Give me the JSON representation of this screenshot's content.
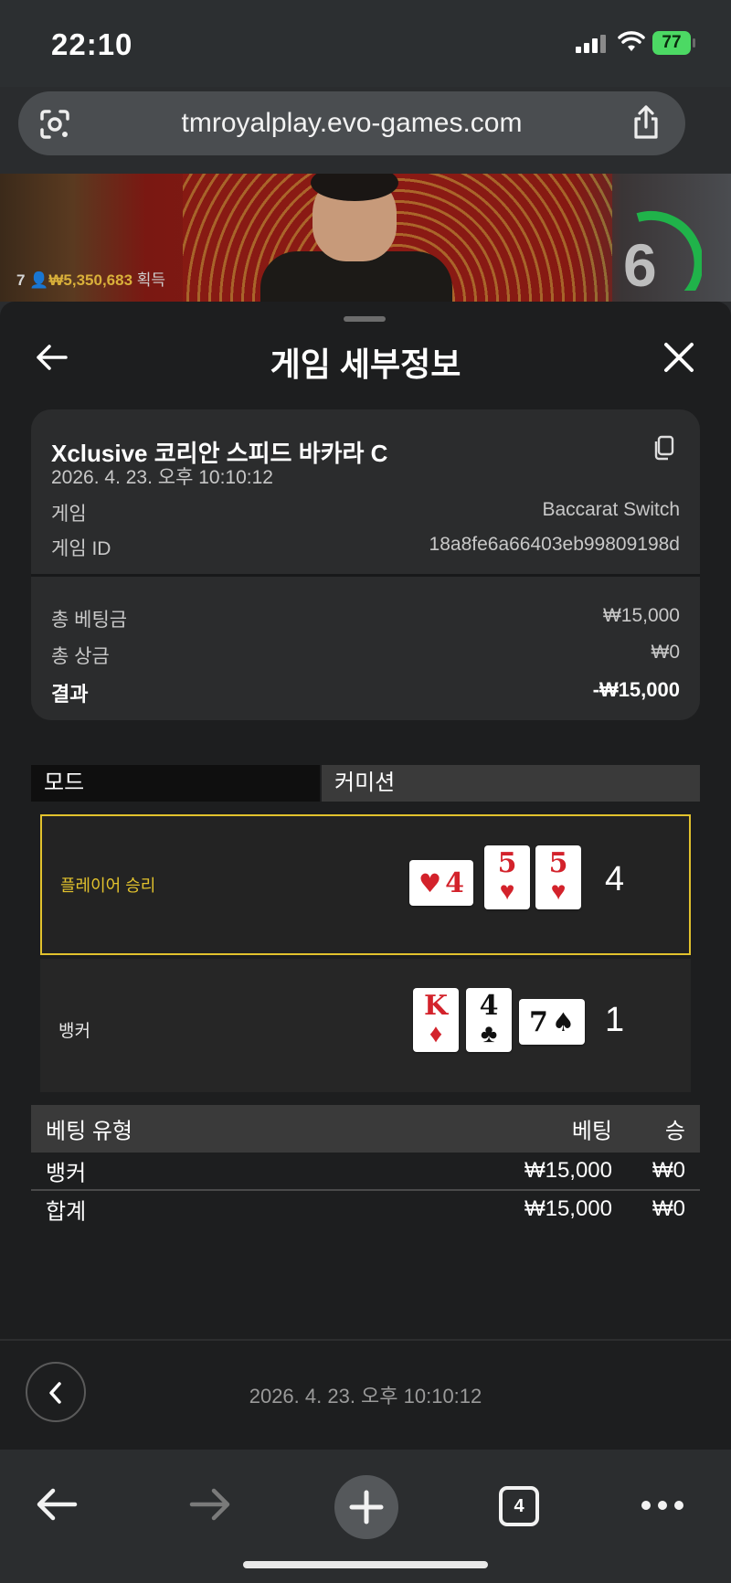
{
  "status": {
    "time": "22:10",
    "battery": "77"
  },
  "browser": {
    "url": "tmroyalplay.evo-games.com",
    "tab_count": "4"
  },
  "video": {
    "players": "7",
    "amount": "₩5,350,683",
    "won_label": "획득",
    "timer": "6"
  },
  "sheet": {
    "title": "게임 세부정보",
    "game_name": "Xclusive 코리안 스피드 바카라 C",
    "datetime": "2026. 4. 23. 오후 10:10:12",
    "game_label": "게임",
    "game_value": "Baccarat Switch",
    "game_id_label": "게임 ID",
    "game_id_value": "18a8fe6a66403eb99809198d",
    "total_bet_label": "총 베팅금",
    "total_bet_value": "₩15,000",
    "total_win_label": "총 상금",
    "total_win_value": "₩0",
    "result_label": "결과",
    "result_value": "-₩15,000"
  },
  "mode": {
    "label": "모드",
    "value": "커미션"
  },
  "hands": {
    "player": {
      "label": "플레이어 승리",
      "score": "4",
      "cards": [
        {
          "rank": "4",
          "suit": "♥",
          "color": "red",
          "orientation": "side"
        },
        {
          "rank": "5",
          "suit": "♥",
          "color": "red",
          "orientation": "up"
        },
        {
          "rank": "5",
          "suit": "♥",
          "color": "red",
          "orientation": "up"
        }
      ]
    },
    "banker": {
      "label": "뱅커",
      "score": "1",
      "cards": [
        {
          "rank": "K",
          "suit": "♦",
          "color": "red",
          "orientation": "up"
        },
        {
          "rank": "4",
          "suit": "♣",
          "color": "black",
          "orientation": "up"
        },
        {
          "rank": "7",
          "suit": "♠",
          "color": "black",
          "orientation": "side"
        }
      ]
    }
  },
  "bets": {
    "headers": {
      "type": "베팅 유형",
      "bet": "베팅",
      "win": "승"
    },
    "rows": [
      {
        "type": "뱅커",
        "bet": "₩15,000",
        "win": "₩0"
      }
    ],
    "total": {
      "type": "합계",
      "bet": "₩15,000",
      "win": "₩0"
    }
  },
  "footer": {
    "datetime": "2026. 4. 23. 오후 10:10:12"
  },
  "colors": {
    "accent_gold": "#e2c22d",
    "battery_green": "#4cd964",
    "card_red": "#d3222b"
  }
}
